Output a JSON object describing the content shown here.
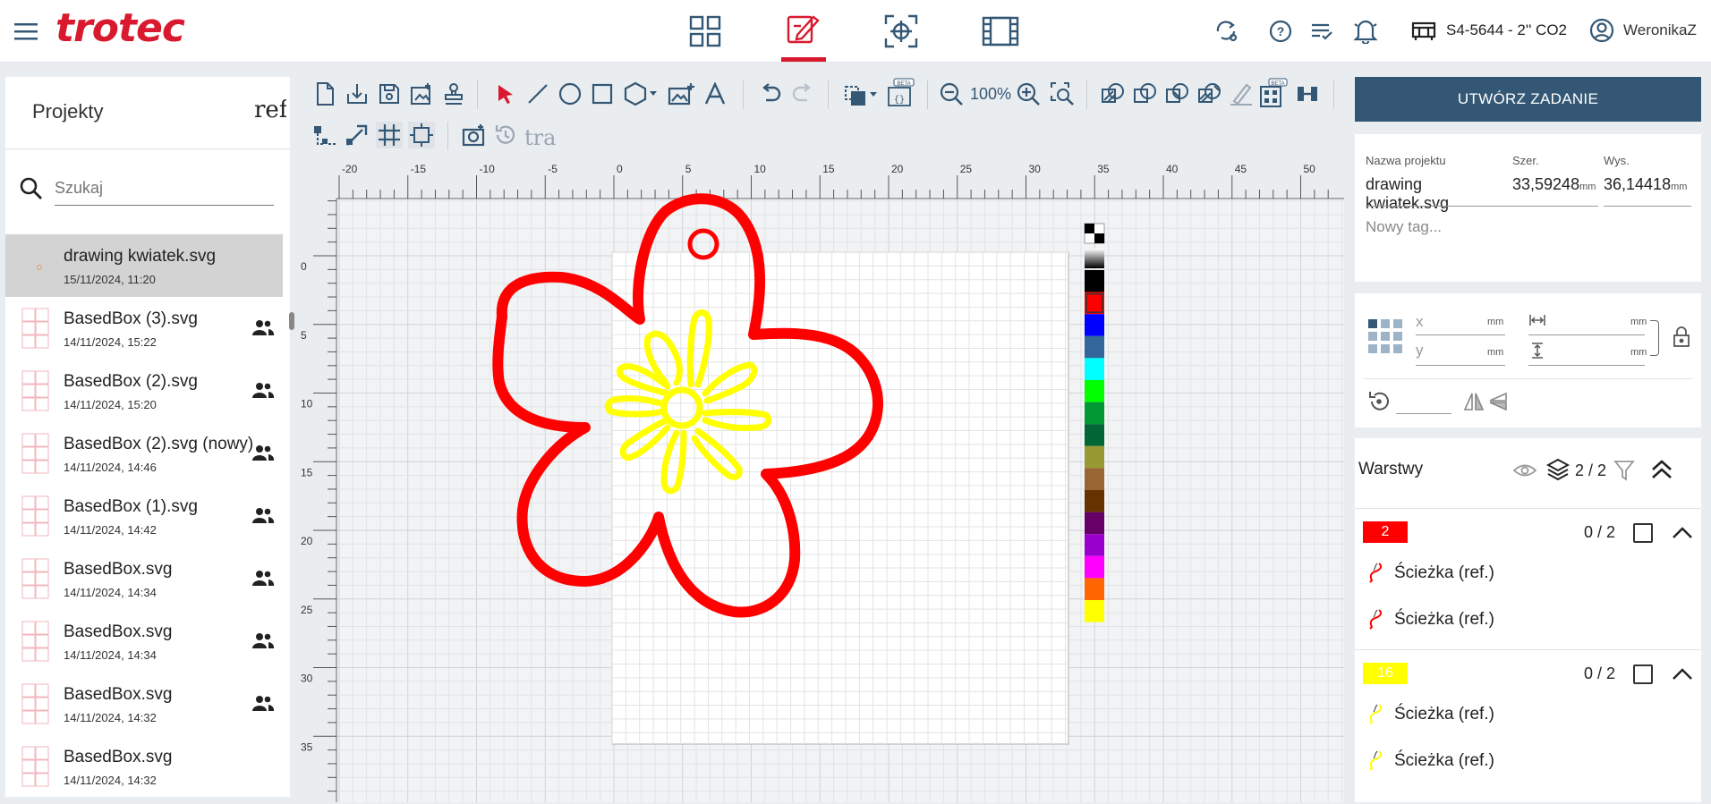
{
  "app": {
    "brand": "trotec"
  },
  "top_tabs": [
    {
      "name": "dashboard-icon"
    },
    {
      "name": "design-edit-icon",
      "active": true
    },
    {
      "name": "position-target-icon"
    },
    {
      "name": "film-icon"
    }
  ],
  "header_right": {
    "machine": "S4-5644 - 2'' CO2",
    "user": "WeronikaZ"
  },
  "projects": {
    "title": "Projekty",
    "title_overflow": "ref",
    "search_placeholder": "Szukaj",
    "files": [
      {
        "name": "drawing kwiatek.svg",
        "date": "15/11/2024, 11:20",
        "selected": true,
        "shared": false
      },
      {
        "name": "BasedBox (3).svg",
        "date": "14/11/2024, 15:22",
        "shared": true
      },
      {
        "name": "BasedBox (2).svg",
        "date": "14/11/2024, 15:20",
        "shared": true
      },
      {
        "name": "BasedBox (2).svg (nowy)",
        "date": "14/11/2024, 14:46",
        "shared": true
      },
      {
        "name": "BasedBox (1).svg",
        "date": "14/11/2024, 14:42",
        "shared": true
      },
      {
        "name": "BasedBox.svg",
        "date": "14/11/2024, 14:34",
        "shared": true
      },
      {
        "name": "BasedBox.svg",
        "date": "14/11/2024, 14:34",
        "shared": true
      },
      {
        "name": "BasedBox.svg",
        "date": "14/11/2024, 14:32",
        "shared": true
      },
      {
        "name": "BasedBox.svg",
        "date": "14/11/2024, 14:32",
        "shared": false
      }
    ]
  },
  "toolbar": {
    "zoom": "100%",
    "beta": "BETA",
    "trace_label": "tra"
  },
  "ruler": {
    "h_labels": [
      "-20",
      "-15",
      "-10",
      "-5",
      "0",
      "5",
      "10",
      "15",
      "20",
      "25",
      "30",
      "35",
      "40",
      "45",
      "50"
    ],
    "v_labels": [
      "0",
      "5",
      "10",
      "15",
      "20",
      "25",
      "30",
      "35"
    ]
  },
  "palette": [
    "#000000",
    "#ff0000",
    "#0000ff",
    "#336699",
    "#00ffff",
    "#00ff00",
    "#009933",
    "#006633",
    "#999933",
    "#996633",
    "#663300",
    "#660066",
    "#9900cc",
    "#ff00ff",
    "#ff6600",
    "#ffff00"
  ],
  "right": {
    "create_button": "UTWÓRZ ZADANIE",
    "project_name_label": "Nazwa projektu",
    "project_name": "drawing kwiatek.svg",
    "width_label": "Szer.",
    "width_value": "33,59248",
    "height_label": "Wys.",
    "height_value": "36,14418",
    "unit": "mm",
    "tag_placeholder": "Nowy tag...",
    "x_label": "x",
    "y_label": "y",
    "layers_title": "Warstwy",
    "layers_count": "2 / 2",
    "layers": [
      {
        "badge": "2",
        "color": "#ff0000",
        "count": "0 / 2",
        "items": [
          "Ścieżka (ref.)",
          "Ścieżka (ref.)"
        ]
      },
      {
        "badge": "16",
        "color": "#ffff00",
        "count": "0 / 2",
        "items": [
          "Ścieżka (ref.)",
          "Ścieżka (ref.)"
        ]
      }
    ]
  },
  "colors": {
    "brand_red": "#d9192d",
    "header_blue": "#335774",
    "canvas_bg": "#f7f7f7"
  }
}
